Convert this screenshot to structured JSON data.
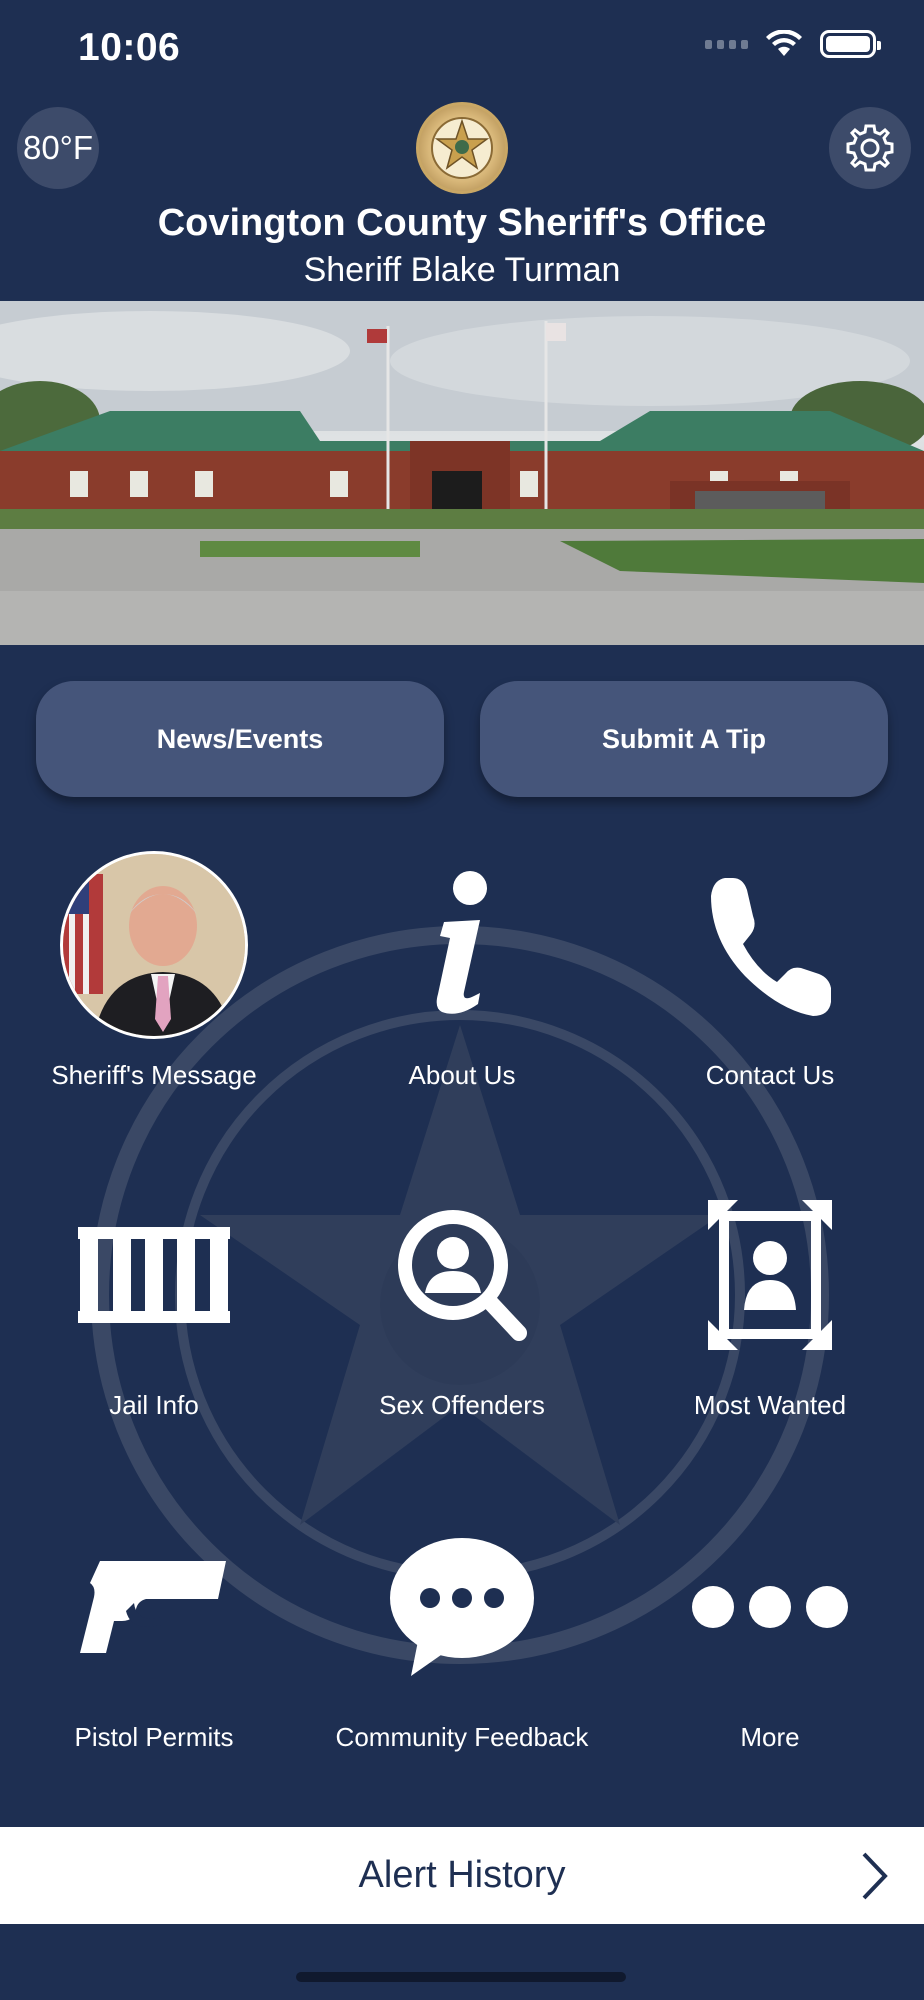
{
  "status_bar": {
    "time": "10:06"
  },
  "header": {
    "weather": "80°F",
    "agency_title": "Covington County Sheriff's Office",
    "sheriff_name": "Sheriff Blake Turman",
    "settings_icon": "gear-icon"
  },
  "actions": {
    "news_label": "News/Events",
    "tip_label": "Submit A Tip"
  },
  "menu": [
    {
      "label": "Sheriff's Message",
      "icon": "sheriff-photo"
    },
    {
      "label": "About Us",
      "icon": "info-icon"
    },
    {
      "label": "Contact Us",
      "icon": "phone-icon"
    },
    {
      "label": "Jail Info",
      "icon": "jail-bars-icon"
    },
    {
      "label": "Sex Offenders",
      "icon": "person-search-icon"
    },
    {
      "label": "Most Wanted",
      "icon": "wanted-poster-icon"
    },
    {
      "label": "Pistol Permits",
      "icon": "pistol-icon"
    },
    {
      "label": "Community Feedback",
      "icon": "chat-bubble-icon"
    },
    {
      "label": "More",
      "icon": "more-dots-icon"
    }
  ],
  "alert_bar": {
    "label": "Alert History"
  },
  "colors": {
    "background": "#1e2f52",
    "button": "#45557a",
    "circle_button": "#3d4b6a",
    "text": "#ffffff",
    "alert_text": "#1e2f52"
  }
}
